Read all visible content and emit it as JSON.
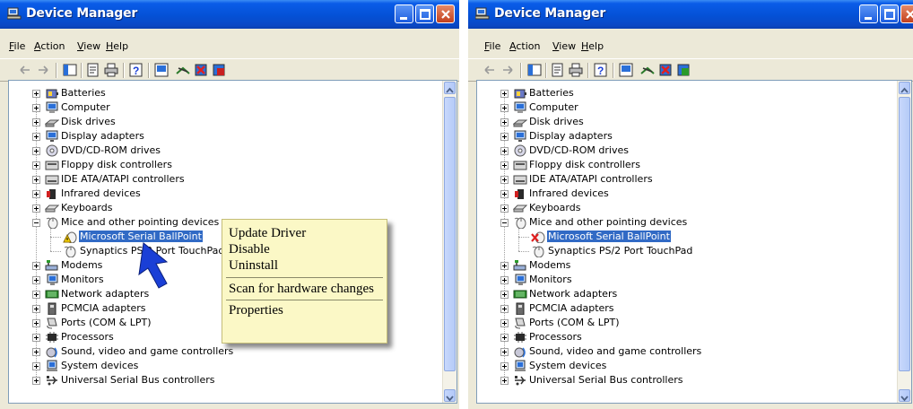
{
  "windows": [
    {
      "id": "left",
      "title": "Device Manager",
      "menu": [
        "File",
        "Action",
        "View",
        "Help"
      ],
      "tree": [
        {
          "label": "Batteries",
          "icon": "battery-icon",
          "expanded": false
        },
        {
          "label": "Computer",
          "icon": "computer-icon",
          "expanded": false
        },
        {
          "label": "Disk drives",
          "icon": "disk-drive-icon",
          "expanded": false
        },
        {
          "label": "Display adapters",
          "icon": "display-adapter-icon",
          "expanded": false
        },
        {
          "label": "DVD/CD-ROM drives",
          "icon": "dvd-drive-icon",
          "expanded": false
        },
        {
          "label": "Floppy disk controllers",
          "icon": "floppy-controller-icon",
          "expanded": false
        },
        {
          "label": "IDE ATA/ATAPI controllers",
          "icon": "ide-controller-icon",
          "expanded": false
        },
        {
          "label": "Infrared devices",
          "icon": "infrared-icon",
          "expanded": false
        },
        {
          "label": "Keyboards",
          "icon": "keyboard-icon",
          "expanded": false
        },
        {
          "label": "Mice and other pointing devices",
          "icon": "mouse-icon",
          "expanded": true,
          "children": [
            {
              "label": "Microsoft Serial BallPoint",
              "icon": "mouse-warning-icon",
              "selected": true
            },
            {
              "label": "Synaptics PS/2 Port TouchPad",
              "icon": "mouse-icon"
            }
          ]
        },
        {
          "label": "Modems",
          "icon": "modem-icon",
          "expanded": false
        },
        {
          "label": "Monitors",
          "icon": "monitor-icon",
          "expanded": false
        },
        {
          "label": "Network adapters",
          "icon": "network-adapter-icon",
          "expanded": false
        },
        {
          "label": "PCMCIA adapters",
          "icon": "pcmcia-icon",
          "expanded": false
        },
        {
          "label": "Ports (COM & LPT)",
          "icon": "port-icon",
          "expanded": false
        },
        {
          "label": "Processors",
          "icon": "processor-icon",
          "expanded": false
        },
        {
          "label": "Sound, video and game controllers",
          "icon": "sound-icon",
          "expanded": false
        },
        {
          "label": "System devices",
          "icon": "system-device-icon",
          "expanded": false
        },
        {
          "label": "Universal Serial Bus controllers",
          "icon": "usb-icon",
          "expanded": false
        }
      ],
      "context_menu": {
        "items": [
          "Update Driver",
          "Disable",
          "Uninstall",
          "Scan for hardware changes",
          "Properties"
        ]
      }
    },
    {
      "id": "right",
      "title": "Device Manager",
      "menu": [
        "File",
        "Action",
        "View",
        "Help"
      ],
      "tree": [
        {
          "label": "Batteries",
          "icon": "battery-icon",
          "expanded": false
        },
        {
          "label": "Computer",
          "icon": "computer-icon",
          "expanded": false
        },
        {
          "label": "Disk drives",
          "icon": "disk-drive-icon",
          "expanded": false
        },
        {
          "label": "Display adapters",
          "icon": "display-adapter-icon",
          "expanded": false
        },
        {
          "label": "DVD/CD-ROM drives",
          "icon": "dvd-drive-icon",
          "expanded": false
        },
        {
          "label": "Floppy disk controllers",
          "icon": "floppy-controller-icon",
          "expanded": false
        },
        {
          "label": "IDE ATA/ATAPI controllers",
          "icon": "ide-controller-icon",
          "expanded": false
        },
        {
          "label": "Infrared devices",
          "icon": "infrared-icon",
          "expanded": false
        },
        {
          "label": "Keyboards",
          "icon": "keyboard-icon",
          "expanded": false
        },
        {
          "label": "Mice and other pointing devices",
          "icon": "mouse-icon",
          "expanded": true,
          "children": [
            {
              "label": "Microsoft Serial BallPoint",
              "icon": "mouse-disabled-icon",
              "selected": true
            },
            {
              "label": "Synaptics PS/2 Port TouchPad",
              "icon": "mouse-icon"
            }
          ]
        },
        {
          "label": "Modems",
          "icon": "modem-icon",
          "expanded": false
        },
        {
          "label": "Monitors",
          "icon": "monitor-icon",
          "expanded": false
        },
        {
          "label": "Network adapters",
          "icon": "network-adapter-icon",
          "expanded": false
        },
        {
          "label": "PCMCIA adapters",
          "icon": "pcmcia-icon",
          "expanded": false
        },
        {
          "label": "Ports (COM & LPT)",
          "icon": "port-icon",
          "expanded": false
        },
        {
          "label": "Processors",
          "icon": "processor-icon",
          "expanded": false
        },
        {
          "label": "Sound, video and game controllers",
          "icon": "sound-icon",
          "expanded": false
        },
        {
          "label": "System devices",
          "icon": "system-device-icon",
          "expanded": false
        },
        {
          "label": "Universal Serial Bus controllers",
          "icon": "usb-icon",
          "expanded": false
        }
      ]
    }
  ],
  "toolbar_icons": [
    "back-icon",
    "forward-icon",
    "show-hide-console-tree-icon",
    "properties-icon",
    "print-icon",
    "help-icon",
    "view-by-type-icon",
    "scan-hardware-icon",
    "uninstall-icon",
    "disable-icon"
  ],
  "colors": {
    "selection": "#316ac5",
    "callout_bg": "#fbf8c6",
    "arrow": "#1a3fd6",
    "titlebar": "#0a5ce8"
  }
}
